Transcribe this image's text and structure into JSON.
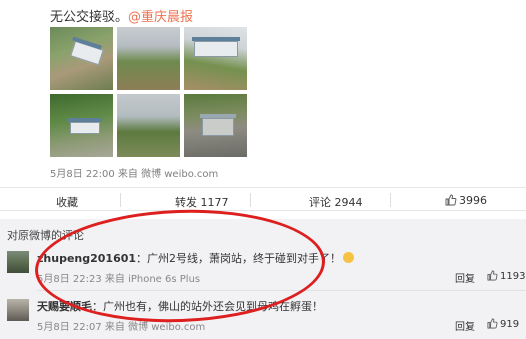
{
  "post": {
    "text": "无公交接驳。",
    "mention": "@重庆晨报",
    "timestamp": "5月8日 22:00 来自 微博 weibo.com"
  },
  "actions": {
    "favorite": "收藏",
    "share": "转发 1177",
    "comment": "评论 2944",
    "like": "3996"
  },
  "comments_section": {
    "title": "对原微博的评论",
    "items": [
      {
        "username": "zhupeng201601",
        "text": "：广州2号线，萧岗站，终于碰到对手了！",
        "meta": "5月8日 22:23 来自 iPhone 6s Plus",
        "reply": "回复",
        "likes": "1193"
      },
      {
        "username": "天赐要顺毛",
        "text": "：广州也有，佛山的站外还会见到母鸡在孵蛋！",
        "meta": "5月8日 22:07 来自 微博 weibo.com",
        "reply": "回复",
        "likes": "919"
      }
    ]
  },
  "colors": {
    "mention": "#eb7350",
    "annotation_circle": "#dd1f1f"
  }
}
